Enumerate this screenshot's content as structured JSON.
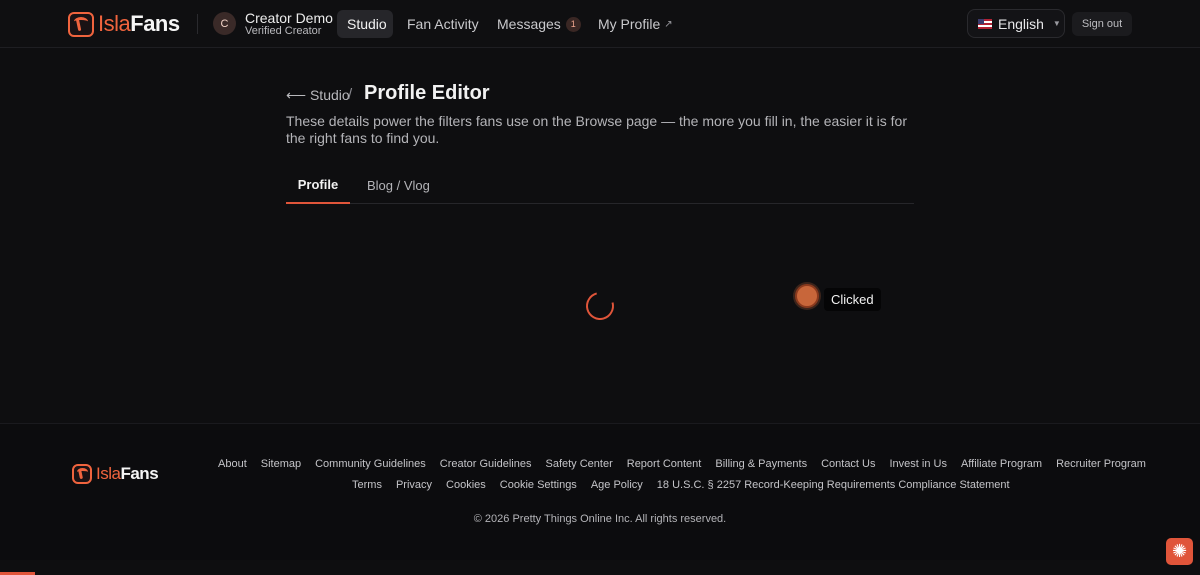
{
  "brand": {
    "name_part1": "Isla",
    "name_part2": "Fans"
  },
  "user": {
    "initial": "C",
    "name": "Creator Demo",
    "role": "Verified Creator"
  },
  "nav": {
    "studio": "Studio",
    "fan_activity": "Fan Activity",
    "messages": "Messages",
    "messages_count": "1",
    "my_profile": "My Profile",
    "external_icon": "↗"
  },
  "language": {
    "label": "English",
    "icon": "us-flag-icon"
  },
  "signout": "Sign out",
  "breadcrumb": {
    "back_label": "⟵ Studio",
    "separator": "/"
  },
  "page": {
    "title": "Profile Editor",
    "description": "These details power the filters fans use on the Browse page — the more you fill in, the easier it is for the right fans to find you."
  },
  "tabs": [
    {
      "label": "Profile",
      "active": true
    },
    {
      "label": "Blog / Vlog",
      "active": false
    }
  ],
  "click_indicator": {
    "label": "Clicked"
  },
  "footer": {
    "links_row1": [
      "About",
      "Sitemap",
      "Community Guidelines",
      "Creator Guidelines",
      "Safety Center",
      "Report Content",
      "Billing & Payments",
      "Contact Us",
      "Invest in Us",
      "Affiliate Program",
      "Recruiter Program"
    ],
    "links_row2": [
      "Terms",
      "Privacy",
      "Cookies",
      "Cookie Settings",
      "Age Policy",
      "18 U.S.C. § 2257 Record-Keeping Requirements Compliance Statement"
    ],
    "copyright": "© 2026 Pretty Things Online Inc. All rights reserved."
  },
  "colors": {
    "accent": "#e0553a",
    "background": "#0e0e10"
  }
}
